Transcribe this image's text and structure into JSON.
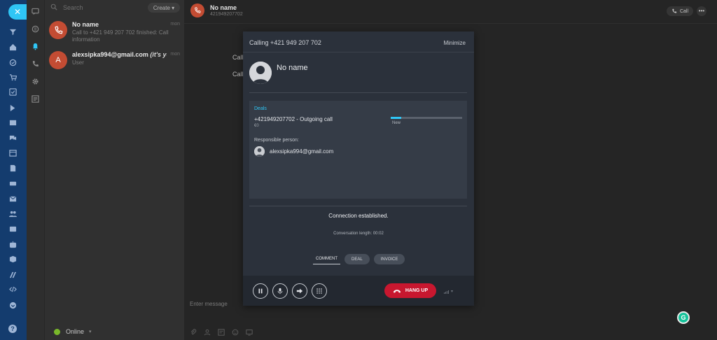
{
  "rail": {
    "close_label": "✕",
    "items": [
      "filter-icon",
      "home-icon",
      "tasks-icon",
      "cart-icon",
      "checkbox-icon",
      "workflow-icon",
      "inbox-icon",
      "chat-icon",
      "calendar-icon",
      "document-icon",
      "drive-icon",
      "mail-icon",
      "contacts-icon",
      "id-card-icon",
      "robot-icon",
      "sites-icon",
      "analytics-icon",
      "code-icon",
      "more-icon"
    ],
    "help_label": "?"
  },
  "subrail": {
    "items": [
      "chat-bubble-icon",
      "channels-icon",
      "notifications-icon",
      "phone-icon",
      "settings-icon",
      "notes-icon"
    ]
  },
  "chatlist": {
    "search_placeholder": "Search",
    "create_label": "Create ▾",
    "items": [
      {
        "avatar": "",
        "name": "No name",
        "time": "mon",
        "preview": "Call to +421 949 207 702 finished: Call information"
      },
      {
        "avatar": "A",
        "name": "alexsipka994@gmail.com",
        "name_suffix": "(it's you)",
        "time": "mon",
        "preview": "User"
      }
    ],
    "status_label": "Online",
    "status_chevron": "▾"
  },
  "main": {
    "title": "No name",
    "subtitle": "421949207702",
    "call_label": "Call",
    "more_label": "•••",
    "message_stubs": [
      "Call",
      "Call"
    ],
    "composer_placeholder": "Enter message",
    "grammarly_label": "G"
  },
  "call_popup": {
    "title": "Calling +421 949 207 702",
    "minimize_label": "Minimize",
    "contact_name": "No name",
    "deals_label": "Deals",
    "deal_title": "+421949207702 - Outgoing call",
    "deal_sum": "€0",
    "stage_label": "New",
    "stage_progress": 0.15,
    "responsible_label": "Responsible person:",
    "responsible_name": "alexsipka994@gmail.com",
    "connection_status": "Connection established.",
    "conversation_length": "Conversation length: 00:02",
    "tabs": [
      "COMMENT",
      "DEAL",
      "INVOICE"
    ],
    "hangup_label": "HANG UP",
    "accent_color": "#2fc6f6",
    "hangup_color": "#c8172f"
  }
}
